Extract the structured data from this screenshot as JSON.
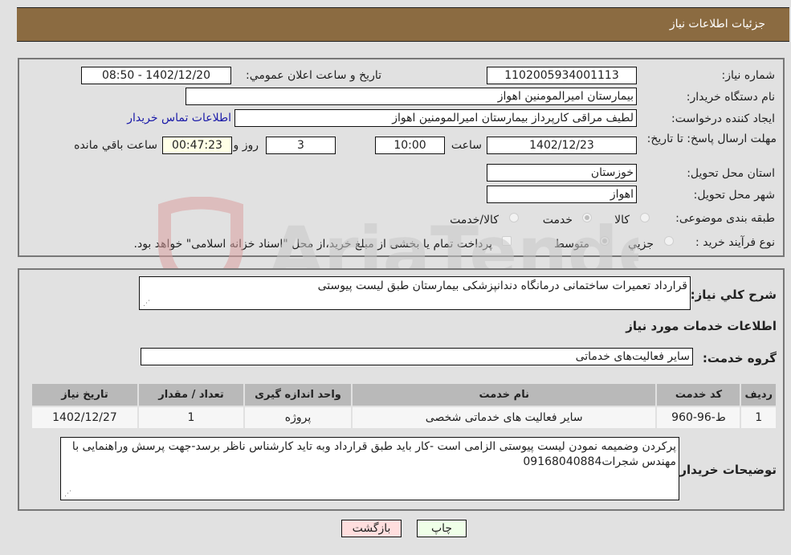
{
  "header": {
    "title": "جزئیات اطلاعات نیاز"
  },
  "form": {
    "need_number": {
      "label": "شماره نیاز:",
      "value": "1102005934001113"
    },
    "announce_datetime": {
      "label": "تاریخ و ساعت اعلان عمومي:",
      "value": "1402/12/20 - 08:50"
    },
    "buyer_org": {
      "label": "نام دستگاه خریدار:",
      "value": "بیمارستان امیرالمومنین اهواز"
    },
    "requester": {
      "label": "ایجاد کننده درخواست:",
      "value": "لطیف مراقی کارپرداز بیمارستان امیرالمومنین اهواز"
    },
    "contact_link": "اطلاعات تماس خریدار",
    "deadline": {
      "label": "مهلت ارسال پاسخ: تا تاریخ:",
      "date": "1402/12/23",
      "time_label": "ساعت",
      "time": "10:00",
      "days": "3",
      "days_label": "روز و",
      "remaining": "00:47:23",
      "remaining_label": "ساعت باقي مانده"
    },
    "province": {
      "label": "استان محل تحویل:",
      "value": "خوزستان"
    },
    "city": {
      "label": "شهر محل تحویل:",
      "value": "اهواز"
    },
    "category": {
      "label": "طبقه بندی موضوعی:",
      "options": [
        "کالا",
        "خدمت",
        "کالا/خدمت"
      ],
      "selected": "خدمت"
    },
    "purchase_type": {
      "label": "نوع فرآیند خرید :",
      "options": [
        "جزیي",
        "متوسط"
      ],
      "selected": "متوسط",
      "treasury_note": "پرداخت تمام یا بخشی از مبلغ خرید،از محل \"اسناد خزانه اسلامی\" خواهد بود.",
      "treasury_checked": false
    }
  },
  "details": {
    "summary_label": "شرح کلي نیاز:",
    "summary_value": "قرارداد تعمیرات ساختمانی درمانگاه دندانپزشکی بیمارستان طبق لیست پیوستی",
    "services_title": "اطلاعات خدمات مورد نیاز",
    "service_group_label": "گروه خدمت:",
    "service_group_value": "سایر فعالیت‌های خدماتی",
    "table": {
      "headers": [
        "ردیف",
        "کد خدمت",
        "نام خدمت",
        "واحد اندازه گیری",
        "تعداد / مقدار",
        "تاریخ نیاز"
      ],
      "rows": [
        [
          "1",
          "ط-96-960",
          "سایر فعالیت های خدماتی شخصی",
          "پروژه",
          "1",
          "1402/12/27"
        ]
      ]
    },
    "buyer_notes_label": "توضیحات خریدار:",
    "buyer_notes_value": "پرکردن وضمیمه نمودن لیست پیوستی الزامی است -کار باید طبق  قرارداد وبه تاید کارشناس ناظر برسد-جهت پرسش وراهنمایی با مهندس شجرات09168040884"
  },
  "buttons": {
    "print": "چاپ",
    "back": "بازگشت"
  },
  "watermark": "AriaTender.neT",
  "colors": {
    "header_bg": "#8b6b41",
    "print_bg": "#efffe8",
    "back_bg": "#ffdede",
    "remaining_bg": "#ffffe6",
    "link": "#1a1aa8"
  }
}
